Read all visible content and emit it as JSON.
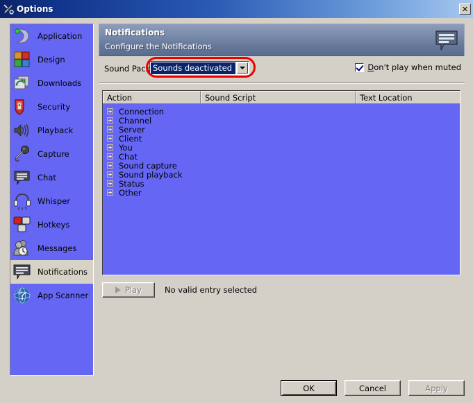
{
  "window": {
    "title": "Options",
    "title_icon": "tools-icon",
    "close_label": "✕"
  },
  "sidebar": {
    "items": [
      {
        "label": "Application",
        "icon": "application-icon",
        "selected": false
      },
      {
        "label": "Design",
        "icon": "design-icon",
        "selected": false
      },
      {
        "label": "Downloads",
        "icon": "downloads-icon",
        "selected": false
      },
      {
        "label": "Security",
        "icon": "security-shield-icon",
        "selected": false
      },
      {
        "label": "Playback",
        "icon": "speaker-icon",
        "selected": false
      },
      {
        "label": "Capture",
        "icon": "microphone-icon",
        "selected": false
      },
      {
        "label": "Chat",
        "icon": "chat-bubble-icon",
        "selected": false
      },
      {
        "label": "Whisper",
        "icon": "headset-icon",
        "selected": false
      },
      {
        "label": "Hotkeys",
        "icon": "hotkeys-icon",
        "selected": false
      },
      {
        "label": "Messages",
        "icon": "messages-icon",
        "selected": false
      },
      {
        "label": "Notifications",
        "icon": "notifications-icon",
        "selected": true
      },
      {
        "label": "App Scanner",
        "icon": "app-scanner-icon",
        "selected": false
      }
    ]
  },
  "banner": {
    "title": "Notifications",
    "subtitle": "Configure the Notifications",
    "icon": "notifications-bubble-icon"
  },
  "sound_pack": {
    "label": "Sound Pack:",
    "selected_value": "Sounds deactivated",
    "dropdown_icon": "chevron-down-icon",
    "highlight_color": "#ee0000"
  },
  "mute_option": {
    "label_prefix": "D",
    "label_rest": "on't play when muted",
    "checked": true
  },
  "listview": {
    "columns": [
      "Action",
      "Sound Script",
      "Text Location"
    ],
    "rows": [
      {
        "action": "Connection",
        "sound_script": "",
        "text_location": ""
      },
      {
        "action": "Channel",
        "sound_script": "",
        "text_location": ""
      },
      {
        "action": "Server",
        "sound_script": "",
        "text_location": ""
      },
      {
        "action": "Client",
        "sound_script": "",
        "text_location": ""
      },
      {
        "action": "You",
        "sound_script": "",
        "text_location": ""
      },
      {
        "action": "Chat",
        "sound_script": "",
        "text_location": ""
      },
      {
        "action": "Sound capture",
        "sound_script": "",
        "text_location": ""
      },
      {
        "action": "Sound playback",
        "sound_script": "",
        "text_location": ""
      },
      {
        "action": "Status",
        "sound_script": "",
        "text_location": ""
      },
      {
        "action": "Other",
        "sound_script": "",
        "text_location": ""
      }
    ]
  },
  "play_row": {
    "button_label": "Play",
    "button_icon": "play-triangle-icon",
    "button_disabled": true,
    "status_text": "No valid entry selected"
  },
  "footer": {
    "ok_label": "OK",
    "cancel_label": "Cancel",
    "apply_label": "Apply",
    "apply_disabled": true
  }
}
